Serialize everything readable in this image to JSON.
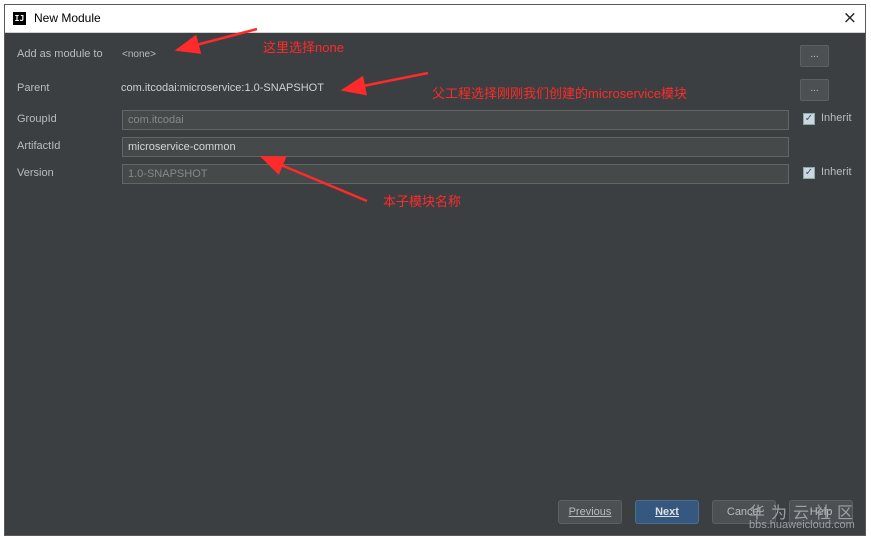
{
  "window": {
    "title": "New Module",
    "close_glyph": "×",
    "app_icon_text": "IJ"
  },
  "form": {
    "add_as_module_to": {
      "label": "Add as module to",
      "value": "<none>"
    },
    "parent": {
      "label": "Parent",
      "value": "com.itcodai:microservice:1.0-SNAPSHOT"
    },
    "group_id": {
      "label": "GroupId",
      "value": "com.itcodai",
      "inherit": true
    },
    "artifact_id": {
      "label": "ArtifactId",
      "value": "microservice-common"
    },
    "version": {
      "label": "Version",
      "value": "1.0-SNAPSHOT",
      "inherit": true
    },
    "browse_label": "...",
    "inherit_label": "Inherit",
    "checkmark": "✓"
  },
  "annotations": {
    "none_note": "这里选择none",
    "parent_note": "父工程选择刚刚我们创建的microservice模块",
    "artifact_note": "本子模块名称",
    "color": "#ff2a2a"
  },
  "buttons": {
    "previous": "Previous",
    "next": "Next",
    "cancel": "Cancel",
    "help": "Help"
  },
  "watermark": {
    "name": "华为云社区",
    "url": "bbs.huaweicloud.com"
  }
}
